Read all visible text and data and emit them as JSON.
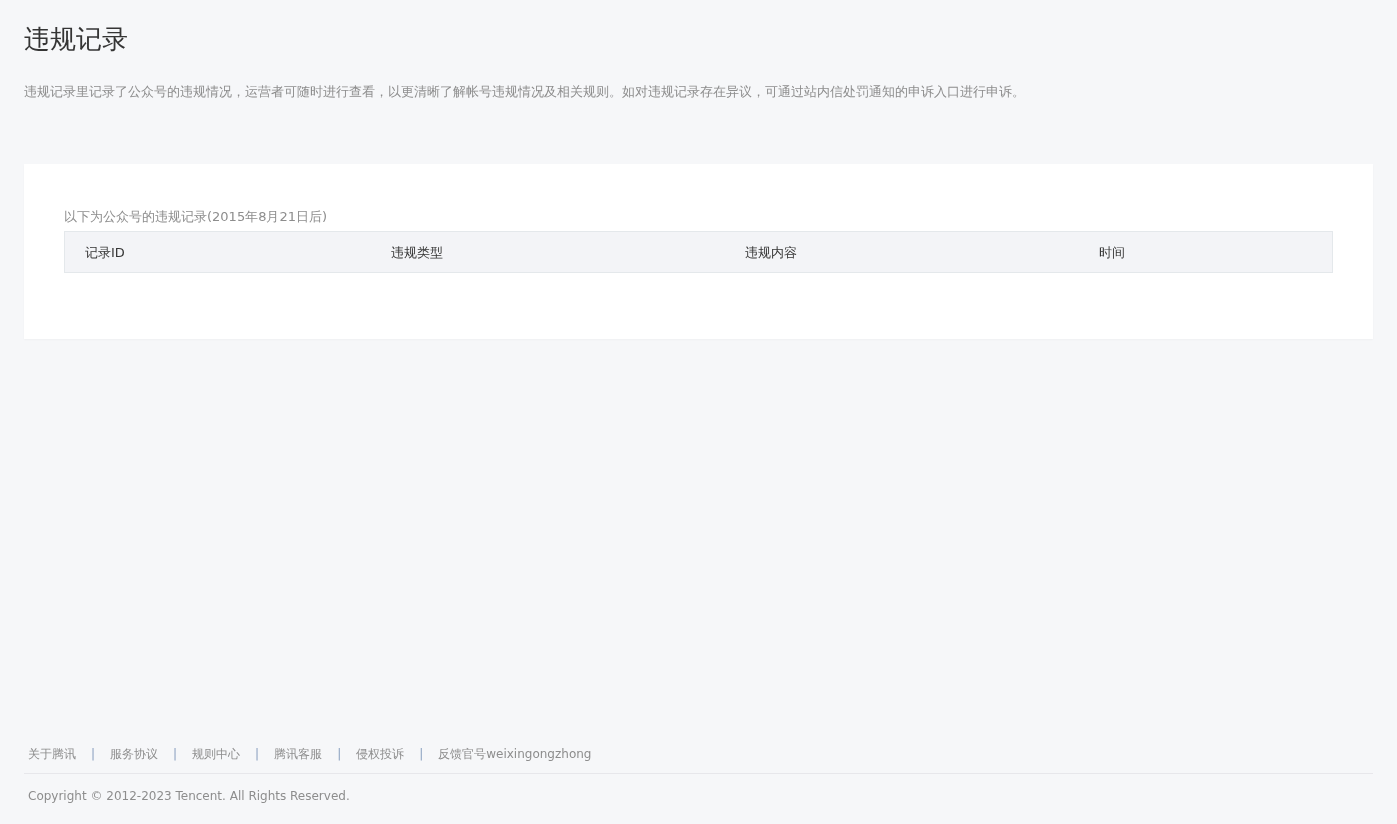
{
  "page": {
    "title": "违规记录",
    "description": "违规记录里记录了公众号的违规情况，运营者可随时进行查看，以更清晰了解帐号违规情况及相关规则。如对违规记录存在异议，可通过站内信处罚通知的申诉入口进行申诉。"
  },
  "records": {
    "caption": "以下为公众号的违规记录(2015年8月21日后)",
    "columns": [
      "记录ID",
      "违规类型",
      "违规内容",
      "时间"
    ]
  },
  "footer": {
    "items": [
      {
        "kind": "link",
        "text": "关于腾讯"
      },
      {
        "kind": "separator",
        "text": "|"
      },
      {
        "kind": "link",
        "text": "服务协议"
      },
      {
        "kind": "separator",
        "text": "|"
      },
      {
        "kind": "link",
        "text": "规则中心"
      },
      {
        "kind": "separator",
        "text": "|"
      },
      {
        "kind": "link",
        "text": "腾讯客服"
      },
      {
        "kind": "separator",
        "text": "|"
      },
      {
        "kind": "link",
        "text": "侵权投诉"
      },
      {
        "kind": "separator",
        "text": "|"
      },
      {
        "kind": "link",
        "text": "反馈官号weixingongzhong"
      }
    ],
    "copyright": "Copyright © 2012-2023 Tencent. All Rights Reserved."
  }
}
